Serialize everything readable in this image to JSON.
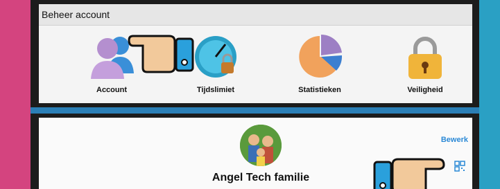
{
  "header": {
    "title": "Beheer account"
  },
  "tiles": [
    {
      "label": "Account",
      "icon": "users-icon"
    },
    {
      "label": "Tijdslimiet",
      "icon": "timer-lock-icon"
    },
    {
      "label": "Statistieken",
      "icon": "pie-chart-icon"
    },
    {
      "label": "Veiligheid",
      "icon": "padlock-icon"
    }
  ],
  "profile": {
    "name": "Angel Tech familie",
    "edit_label": "Bewerk",
    "qr_icon": "qr-code-icon",
    "avatar_icon": "family-avatar-icon"
  },
  "colors": {
    "accent": "#2b89d6",
    "border_left": "#d4447f",
    "border_right": "#2aa0c4"
  }
}
